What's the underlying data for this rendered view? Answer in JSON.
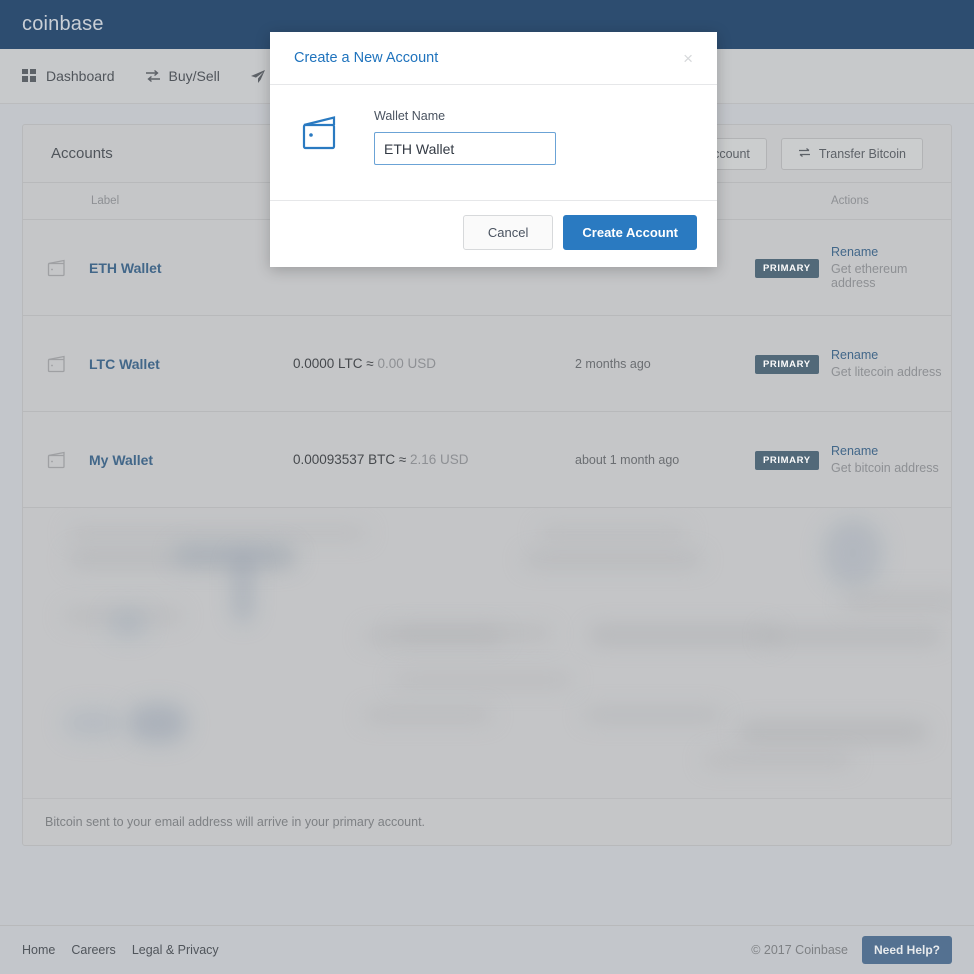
{
  "header": {
    "brand": "coinbase",
    "brand_bg": "#0b53a3"
  },
  "nav": {
    "items": [
      {
        "label": "Dashboard",
        "icon": "grid-icon"
      },
      {
        "label": "Buy/Sell",
        "icon": "exchange-icon"
      },
      {
        "label": "Send",
        "icon": "send-icon"
      }
    ]
  },
  "accounts_card": {
    "title": "Accounts",
    "buttons": [
      {
        "label": "New Account",
        "icon": "plus-icon"
      },
      {
        "label": "Transfer Bitcoin",
        "icon": "transfer-icon"
      }
    ],
    "columns": [
      "Label",
      "Actions"
    ],
    "rows": [
      {
        "icon": "wallet-icon",
        "name": "ETH Wallet",
        "balance": "",
        "balance_usd": "",
        "time": "",
        "badge": "PRIMARY",
        "action": "Rename",
        "action_sub": "Get ethereum address"
      },
      {
        "icon": "wallet-icon",
        "name": "LTC Wallet",
        "balance": "0.0000 LTC ≈ ",
        "balance_usd": "0.00 USD",
        "time": "2 months ago",
        "badge": "PRIMARY",
        "action": "Rename",
        "action_sub": "Get litecoin address"
      },
      {
        "icon": "wallet-icon",
        "name": "My Wallet",
        "balance": "0.00093537 BTC ≈ ",
        "balance_usd": "2.16 USD",
        "time": "about 1 month ago",
        "badge": "PRIMARY",
        "action": "Rename",
        "action_sub": "Get bitcoin address"
      }
    ],
    "note": "Bitcoin sent to your email address will arrive in your primary account."
  },
  "footer": {
    "links": [
      "Home",
      "Careers",
      "Legal & Privacy"
    ],
    "copyright": "© 2017 Coinbase",
    "help_button": "Need Help?"
  },
  "modal": {
    "title": "Create a New Account",
    "close_icon": "×",
    "icon": "wallet-icon",
    "field_label": "Wallet Name",
    "field_value": "ETH Wallet",
    "cancel_label": "Cancel",
    "submit_label": "Create Account",
    "accent": "#2a7ac1"
  }
}
